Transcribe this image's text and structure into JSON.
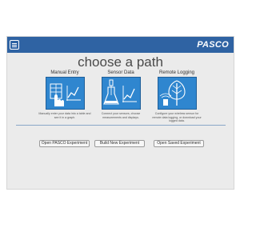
{
  "app": {
    "brand": "PASCO"
  },
  "header": {
    "accent_color": "#2f63a3"
  },
  "page": {
    "title": "choose a path"
  },
  "paths": [
    {
      "label": "Manual Entry",
      "icon": "hand-table-graph-icon",
      "description": "Manually enter your data into a table and see it in a graph."
    },
    {
      "label": "Sensor Data",
      "icon": "flask-graph-icon",
      "description": "Connect your sensors, choose measurements and displays."
    },
    {
      "label": "Remote Logging",
      "icon": "tree-sensor-icon",
      "description": "Configure your wireless sensor for remote data logging, or download your logged data."
    }
  ],
  "actions": {
    "open_pasco": "Open PASCO Experiment",
    "build_new": "Build New Experiment",
    "open_saved": "Open Saved Experiment"
  }
}
